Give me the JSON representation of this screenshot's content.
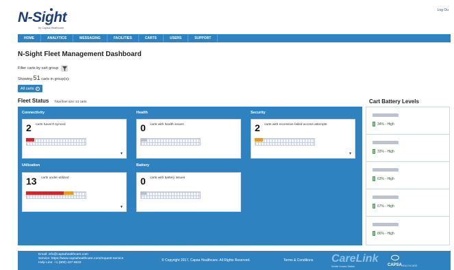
{
  "header": {
    "logo": "N-Sight",
    "logo_sub": "by Capsa Healthcare",
    "logout": "Log Ou"
  },
  "nav": {
    "items": [
      "HOME",
      "ANALYTICS",
      "MESSAGING",
      "FACILITIES",
      "CARTS",
      "USERS",
      "SUPPORT"
    ]
  },
  "page": {
    "title": "N-Sight Fleet Management Dashboard",
    "filter_label": "Filter carts by cart group",
    "showing_prefix": "Showing",
    "showing_count": "51",
    "showing_suffix": "carts in group(s):",
    "chip_label": "All carts",
    "chip_close": "×"
  },
  "fleet": {
    "title": "Fleet Status",
    "total": "Total fleet size: 51 carts",
    "cards": [
      {
        "section": "Connectivity",
        "value": "2",
        "desc": "carts haven't synced",
        "fill_color": "#cc2a2a",
        "fill_fraction": 0.14,
        "sort": "▼"
      },
      {
        "section": "Health",
        "value": "0",
        "desc": "carts with health issues",
        "fill_color": "#b7c2cc",
        "fill_fraction": 0.1,
        "sort": ""
      },
      {
        "section": "Security",
        "value": "2",
        "desc": "carts with excessive failed access attempts",
        "fill_color": "#e59a2e",
        "fill_fraction": 0.14,
        "sort": "▼"
      },
      {
        "section": "Utilization",
        "value": "13",
        "desc": "carts under-utilized",
        "fill_color": "#cc2a2a",
        "fill_fraction": 0.78,
        "sort": "▼"
      },
      {
        "section": "Battery",
        "value": "0",
        "desc": "carts with battery issues",
        "fill_color": "#b7c2cc",
        "fill_fraction": 0.1,
        "sort": ""
      }
    ]
  },
  "battery": {
    "title": "Cart Battery Levels",
    "items": [
      {
        "value": "34% - High"
      },
      {
        "value": "33% - High"
      },
      {
        "value": "63% - High"
      },
      {
        "value": "67% - High"
      },
      {
        "value": "86% - High"
      }
    ]
  },
  "footer": {
    "email": "Email: info@capsahealthcare.com",
    "service": "Service: https://www.capsahealthcare.com/request-service",
    "help": "Help Line: +1 (800) 437-6633",
    "copyright": "© Copyright 2017, Capsa Healthcare. All Rights Reserved.",
    "terms": "Terms & Conditions",
    "brand": "CareLink",
    "brand_sub": "Mobile Nurses Station",
    "capsa": "CAPSA",
    "capsa_sub": "HEALTHCARE"
  },
  "colors": {
    "primary": "#2f82c0",
    "alert": "#cc2a2a",
    "warning": "#e59a2e",
    "battery_ok": "#5a8f5a"
  }
}
